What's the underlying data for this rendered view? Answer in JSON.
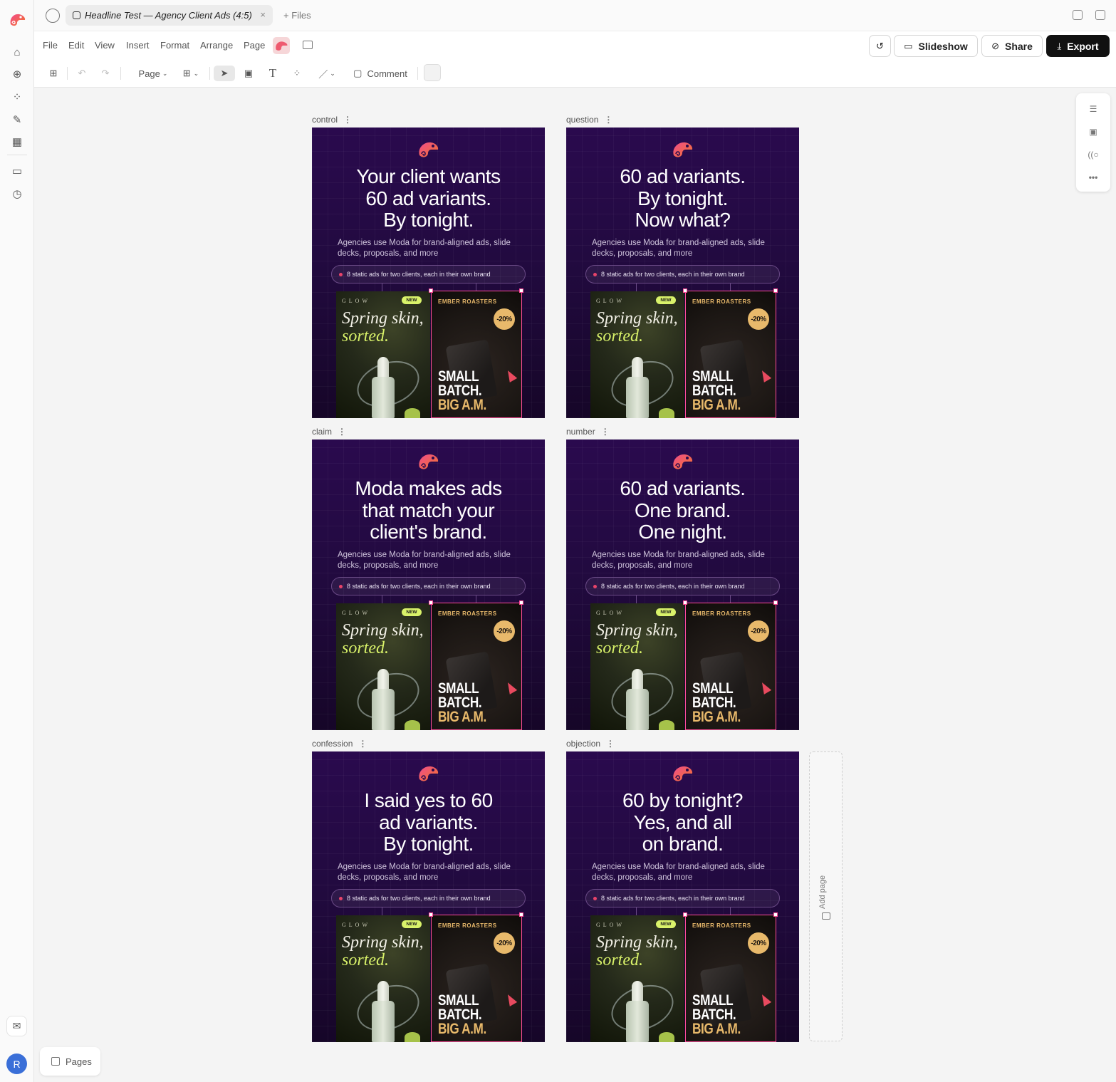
{
  "tabbar": {
    "tab_title": "Headline Test — Agency Client Ads (4:5)",
    "close": "×",
    "files_label": "+ Files"
  },
  "menu": {
    "items": [
      "File",
      "Edit",
      "View",
      "Insert",
      "Format",
      "Arrange",
      "Page"
    ]
  },
  "actions": {
    "slideshow": "Slideshow",
    "share": "Share",
    "export": "Export"
  },
  "toolbar": {
    "page_label": "Page",
    "comment_label": "Comment"
  },
  "ad_common": {
    "sub": "Agencies use Moda for brand-aligned ads, slide decks, proposals, and more",
    "pill": "8 static ads for two clients, each in their own brand",
    "glow_brand": "GLOW",
    "new_badge": "NEW",
    "spring_line1": "Spring skin,",
    "spring_line2": "sorted.",
    "ember_brand": "EMBER ROASTERS",
    "discount": "-20%",
    "big_line1": "SMALL",
    "big_line2": "BATCH.",
    "big_line3": "BIG A.M."
  },
  "pages": [
    {
      "label": "control",
      "headline": [
        "Your client wants",
        "60 ad variants.",
        "By tonight."
      ]
    },
    {
      "label": "question",
      "headline": [
        "60 ad variants.",
        "By tonight.",
        "Now what?"
      ]
    },
    {
      "label": "claim",
      "headline": [
        "Moda makes ads",
        "that match your",
        "client's brand."
      ]
    },
    {
      "label": "number",
      "headline": [
        "60 ad variants.",
        "One brand.",
        "One night."
      ]
    },
    {
      "label": "confession",
      "headline": [
        "I said yes to 60",
        "ad variants.",
        "By tonight."
      ]
    },
    {
      "label": "objection",
      "headline": [
        "60 by tonight?",
        "Yes, and all",
        "on brand."
      ]
    }
  ],
  "add_page": "Add page",
  "pages_button": "Pages",
  "user_initial": "R",
  "colors": {
    "ad_bg": "#2a0a4e",
    "accent_lime": "#d9f26a",
    "accent_gold": "#e8b96b",
    "selection_pink": "#ff4d9a",
    "avatar_blue": "#3a6fd8"
  }
}
